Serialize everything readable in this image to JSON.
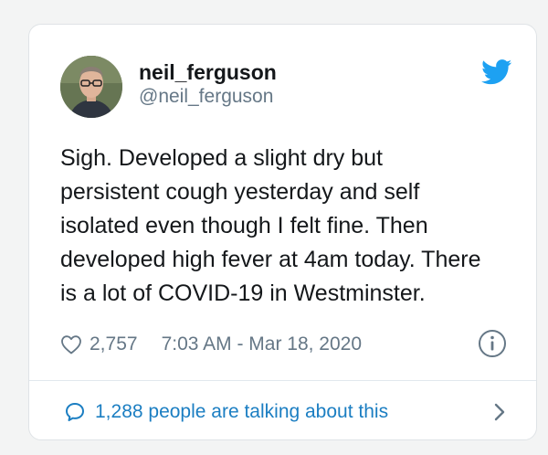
{
  "tweet": {
    "display_name": "neil_ferguson",
    "handle": "@neil_ferguson",
    "text": "Sigh. Developed a slight dry but\npersistent cough yesterday and self\nisolated even though I felt fine. Then\ndeveloped high fever at 4am today. There\nis a lot of COVID-19 in Westminster.",
    "likes": "2,757",
    "timestamp": "7:03 AM - Mar 18, 2020",
    "talking": "1,288 people are talking about this"
  },
  "icons": {
    "brand": "twitter-bird-icon",
    "like": "heart-icon",
    "info": "info-icon",
    "conversation": "speech-bubble-icon",
    "expand": "chevron-right-icon"
  },
  "colors": {
    "brand_blue": "#1da1f2",
    "link_blue": "#1b7ec2",
    "secondary_text": "#657786",
    "primary_text": "#14171a"
  }
}
